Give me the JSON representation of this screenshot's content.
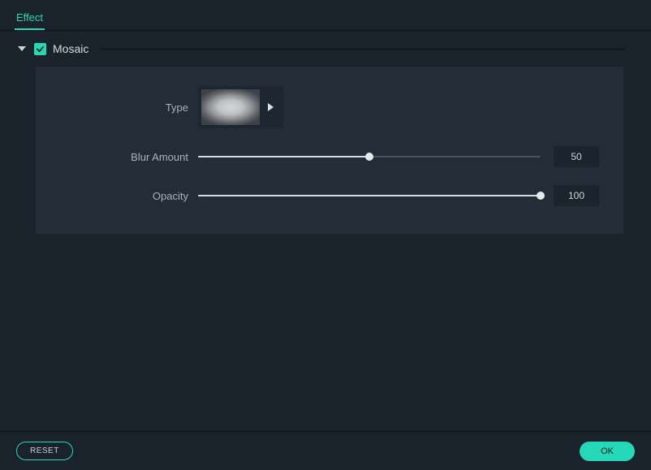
{
  "tab": {
    "label": "Effect"
  },
  "section": {
    "title": "Mosaic",
    "checked": true,
    "expanded": true
  },
  "controls": {
    "type": {
      "label": "Type"
    },
    "blur": {
      "label": "Blur Amount",
      "value": "50",
      "percent": 50
    },
    "opacity": {
      "label": "Opacity",
      "value": "100",
      "percent": 100
    }
  },
  "footer": {
    "reset_label": "RESET",
    "ok_label": "OK"
  },
  "colors": {
    "accent": "#25d9b8",
    "bg": "#1a222b",
    "panel": "#242d37"
  }
}
